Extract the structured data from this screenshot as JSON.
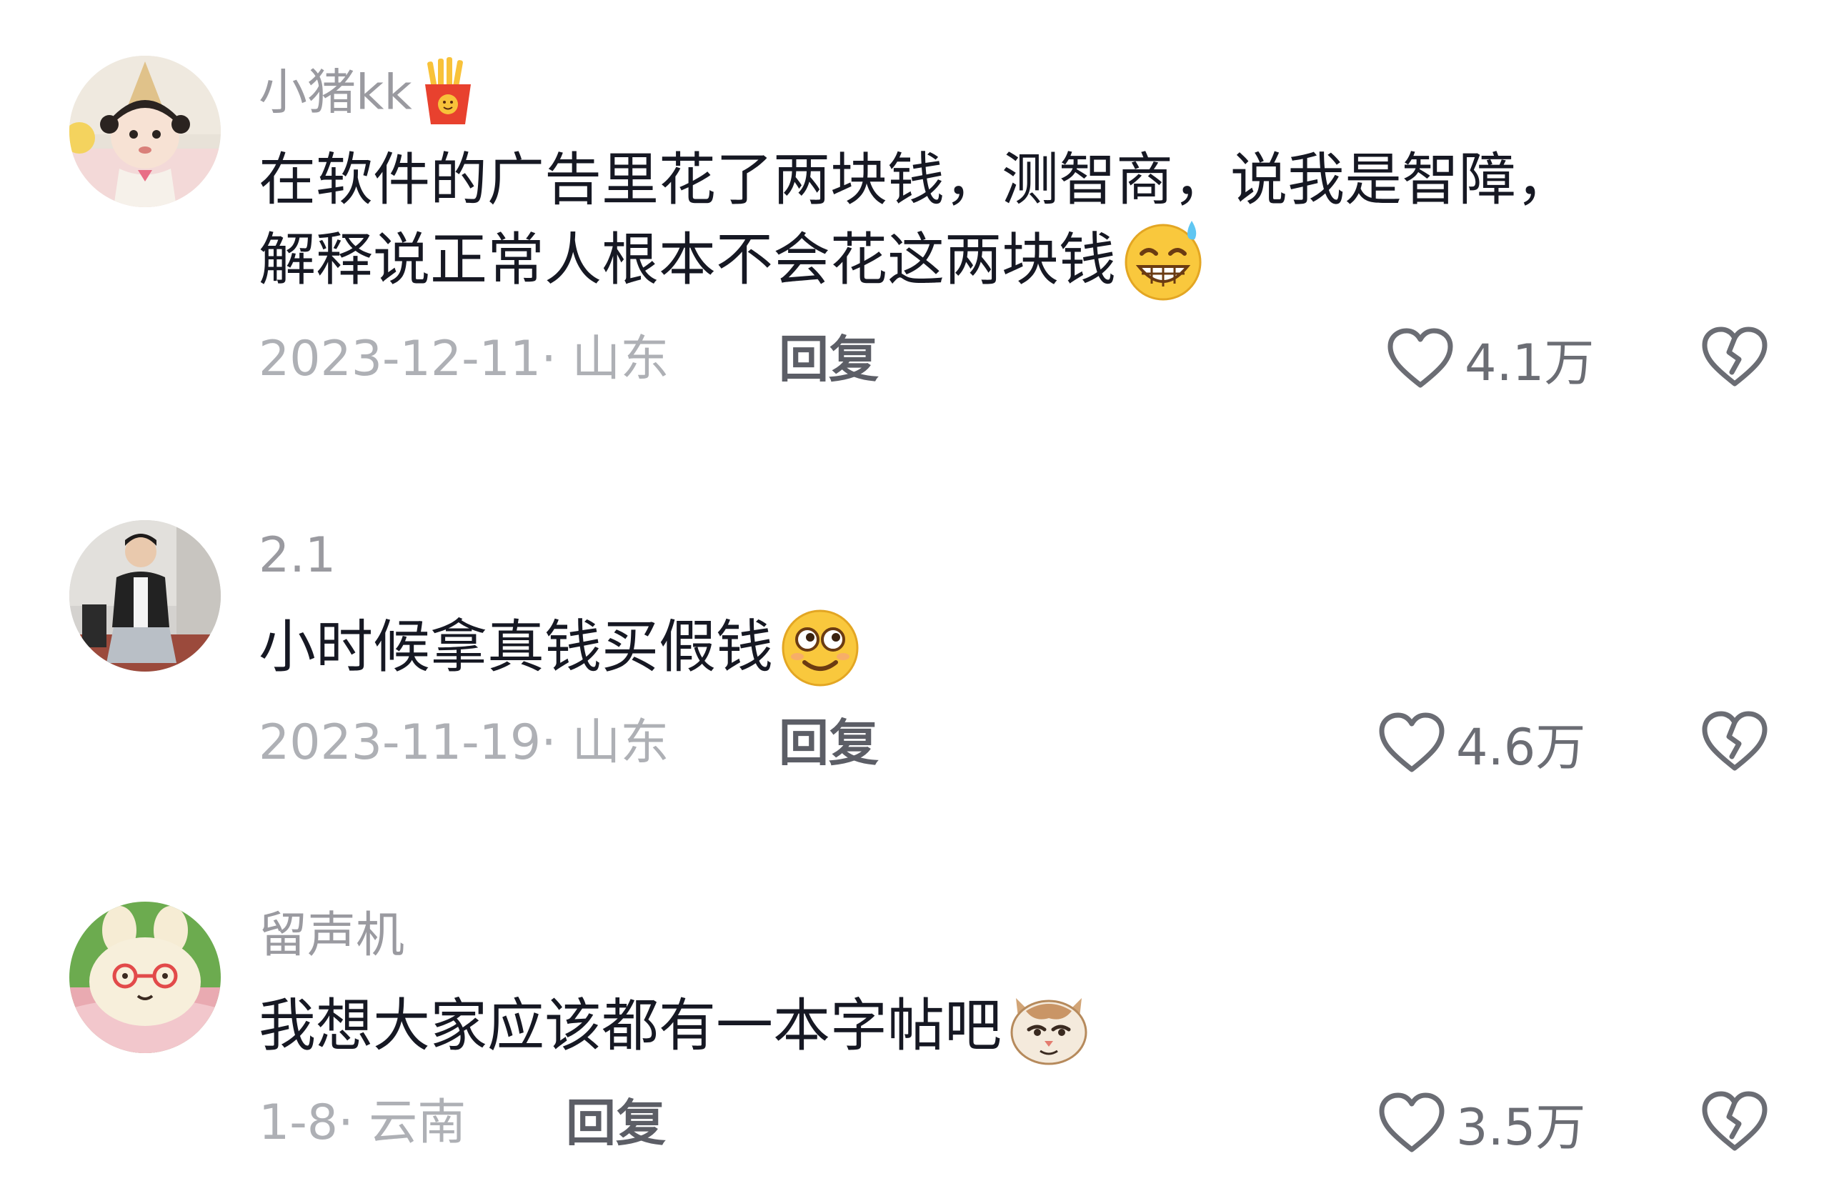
{
  "comments": [
    {
      "username": "小猪kk",
      "badge_icon": "fries-icon",
      "text": "在软件的广告里花了两块钱，测智商，说我是智障，",
      "text_line2": "解释说正常人根本不会花这两块钱",
      "emoji_icon": "sweat-grin-emoji",
      "date": "2023-12-11",
      "location": "· 山东",
      "reply_label": "回复",
      "likes": "4.1万",
      "dislike_icon": "broken-heart-icon"
    },
    {
      "username": "2.1",
      "text": "小时候拿真钱买假钱",
      "emoji_icon": "silly-face-emoji",
      "date": "2023-11-19",
      "location": "· 山东",
      "reply_label": "回复",
      "likes": "4.6万",
      "dislike_icon": "broken-heart-icon"
    },
    {
      "username": "留声机",
      "text": "我想大家应该都有一本字帖吧",
      "emoji_icon": "smug-cat-emoji",
      "date": "1-8",
      "location": "· 云南",
      "reply_label": "回复",
      "likes": "3.5万",
      "dislike_icon": "broken-heart-icon"
    }
  ]
}
